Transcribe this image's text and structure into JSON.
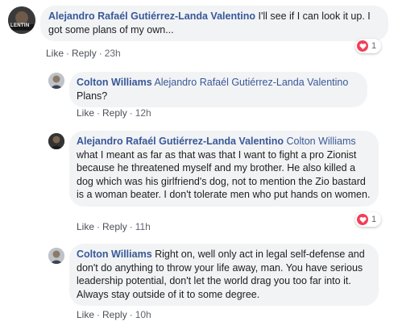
{
  "comments": [
    {
      "author": "Alejandro Rafaél Gutiérrez-Landa Valentino",
      "mention": "",
      "text": "I'll see if I can look it up. I got some plans of my own...",
      "like": "Like",
      "reply": "Reply",
      "time": "23h",
      "reaction_count": "1",
      "avatar_text": "LENTIN"
    },
    {
      "author": "Colton Williams",
      "mention": "Alejandro Rafaél Gutiérrez-Landa Valentino",
      "text": "Plans?",
      "like": "Like",
      "reply": "Reply",
      "time": "12h"
    },
    {
      "author": "Alejandro Rafaél Gutiérrez-Landa Valentino",
      "mention": "Colton Williams",
      "text": "what I meant as far as that was that I want to fight a pro Zionist because he threatened myself and my brother. He also killed a dog which was his girlfriend's dog, not to mention the Zio bastard is a woman beater. I don't tolerate men who put hands on women.",
      "like": "Like",
      "reply": "Reply",
      "time": "11h",
      "reaction_count": "1"
    },
    {
      "author": "Colton Williams",
      "mention": "",
      "text": "Right on, well only act in legal self-defense and don't do anything to throw your life away, man. You have serious leadership potential, don't let the world drag you too far into it. Always stay outside of it to some degree.",
      "like": "Like",
      "reply": "Reply",
      "time": "10h"
    }
  ],
  "colors": {
    "author": "#385898",
    "bubble": "#f2f3f5",
    "heart": "#f33e58"
  }
}
